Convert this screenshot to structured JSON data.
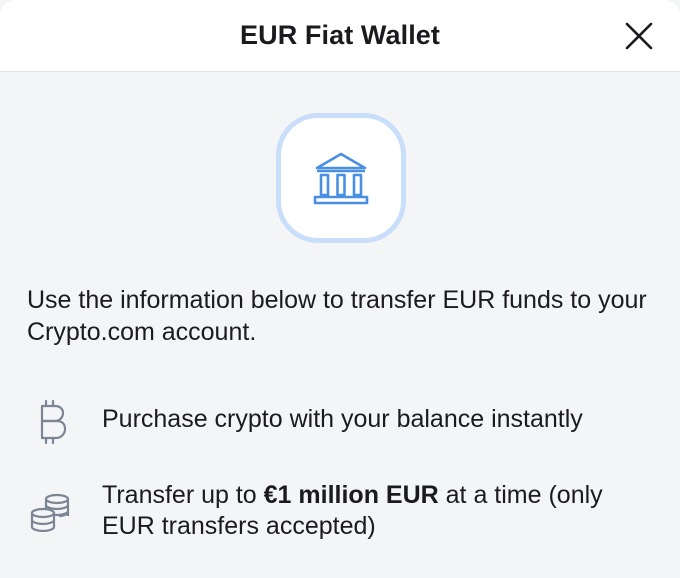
{
  "header": {
    "title": "EUR Fiat Wallet",
    "close_icon": "close-icon"
  },
  "badge": {
    "icon": "bank-icon",
    "accent": "#c9defa",
    "icon_color": "#4a90e2"
  },
  "intro": "Use the information below to transfer EUR funds to your Crypto.com account.",
  "features": [
    {
      "icon": "bitcoin-icon",
      "text": "Purchase crypto with your balance instantly"
    },
    {
      "icon": "coins-icon",
      "text_before": "Transfer up to ",
      "text_bold": "€1 million EUR",
      "text_after": " at a time (only EUR transfers accepted)"
    }
  ]
}
